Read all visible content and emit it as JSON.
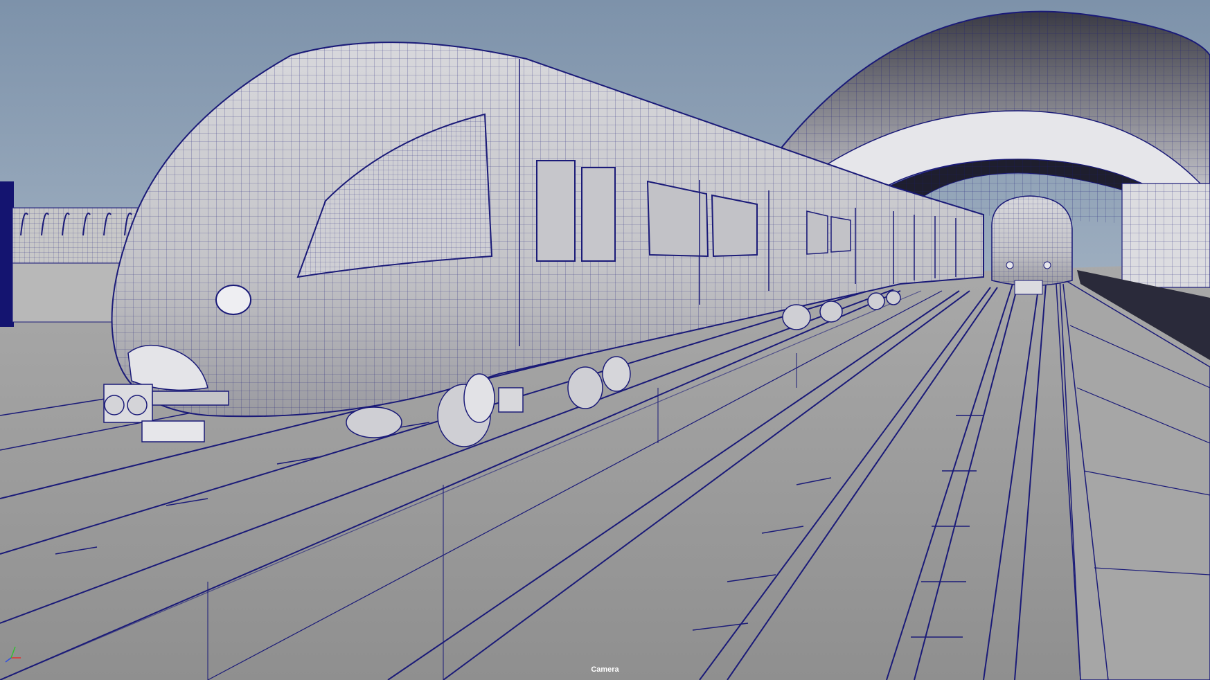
{
  "viewport": {
    "camera_label": "Camera",
    "background_top": "#7d92aa",
    "background_bottom": "#9fb0c0",
    "wireframe_color": "#1a1a78",
    "shaded_color": "#b4b4b4"
  },
  "scene": {
    "objects": [
      "train-front-car",
      "train-rear-car",
      "station-canopy",
      "railway-tracks",
      "platform",
      "background-fence"
    ]
  },
  "axis_gizmo": {
    "icon": "xyz-axis-icon",
    "x_color": "#e03030",
    "y_color": "#30c030",
    "z_color": "#3050e0"
  }
}
